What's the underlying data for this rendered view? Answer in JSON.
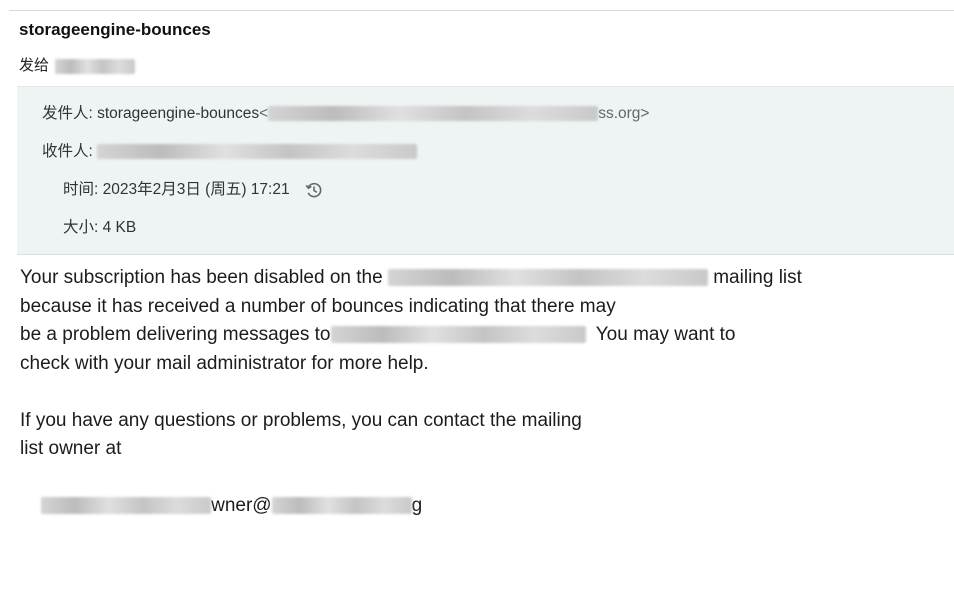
{
  "email": {
    "subject": "storageengine-bounces",
    "to_prefix": "发给",
    "header": {
      "from_label": "发件人:",
      "from_name": "storageengine-bounces",
      "from_addr_open": "<",
      "from_addr_tail": "ss.org>",
      "to_label": "收件人:",
      "time_label": "时间:",
      "time_value": "2023年2月3日 (周五) 17:21",
      "size_label": "大小:",
      "size_value": "4 KB"
    },
    "body": {
      "l1_a": "Your subscription has been disabled on the ",
      "l1_b": " mailing list",
      "l2": "because it has received a number of bounces indicating that there may",
      "l3_a": "be a problem delivering messages to",
      "l3_b": "  You may want to",
      "l4": "check with your mail administrator for more help.",
      "l6": "If you have any questions or problems, you can contact the mailing",
      "l7": "list owner at",
      "l9_a": "wner@",
      "l9_b": "g"
    }
  },
  "icons": {
    "history": "history-icon"
  }
}
